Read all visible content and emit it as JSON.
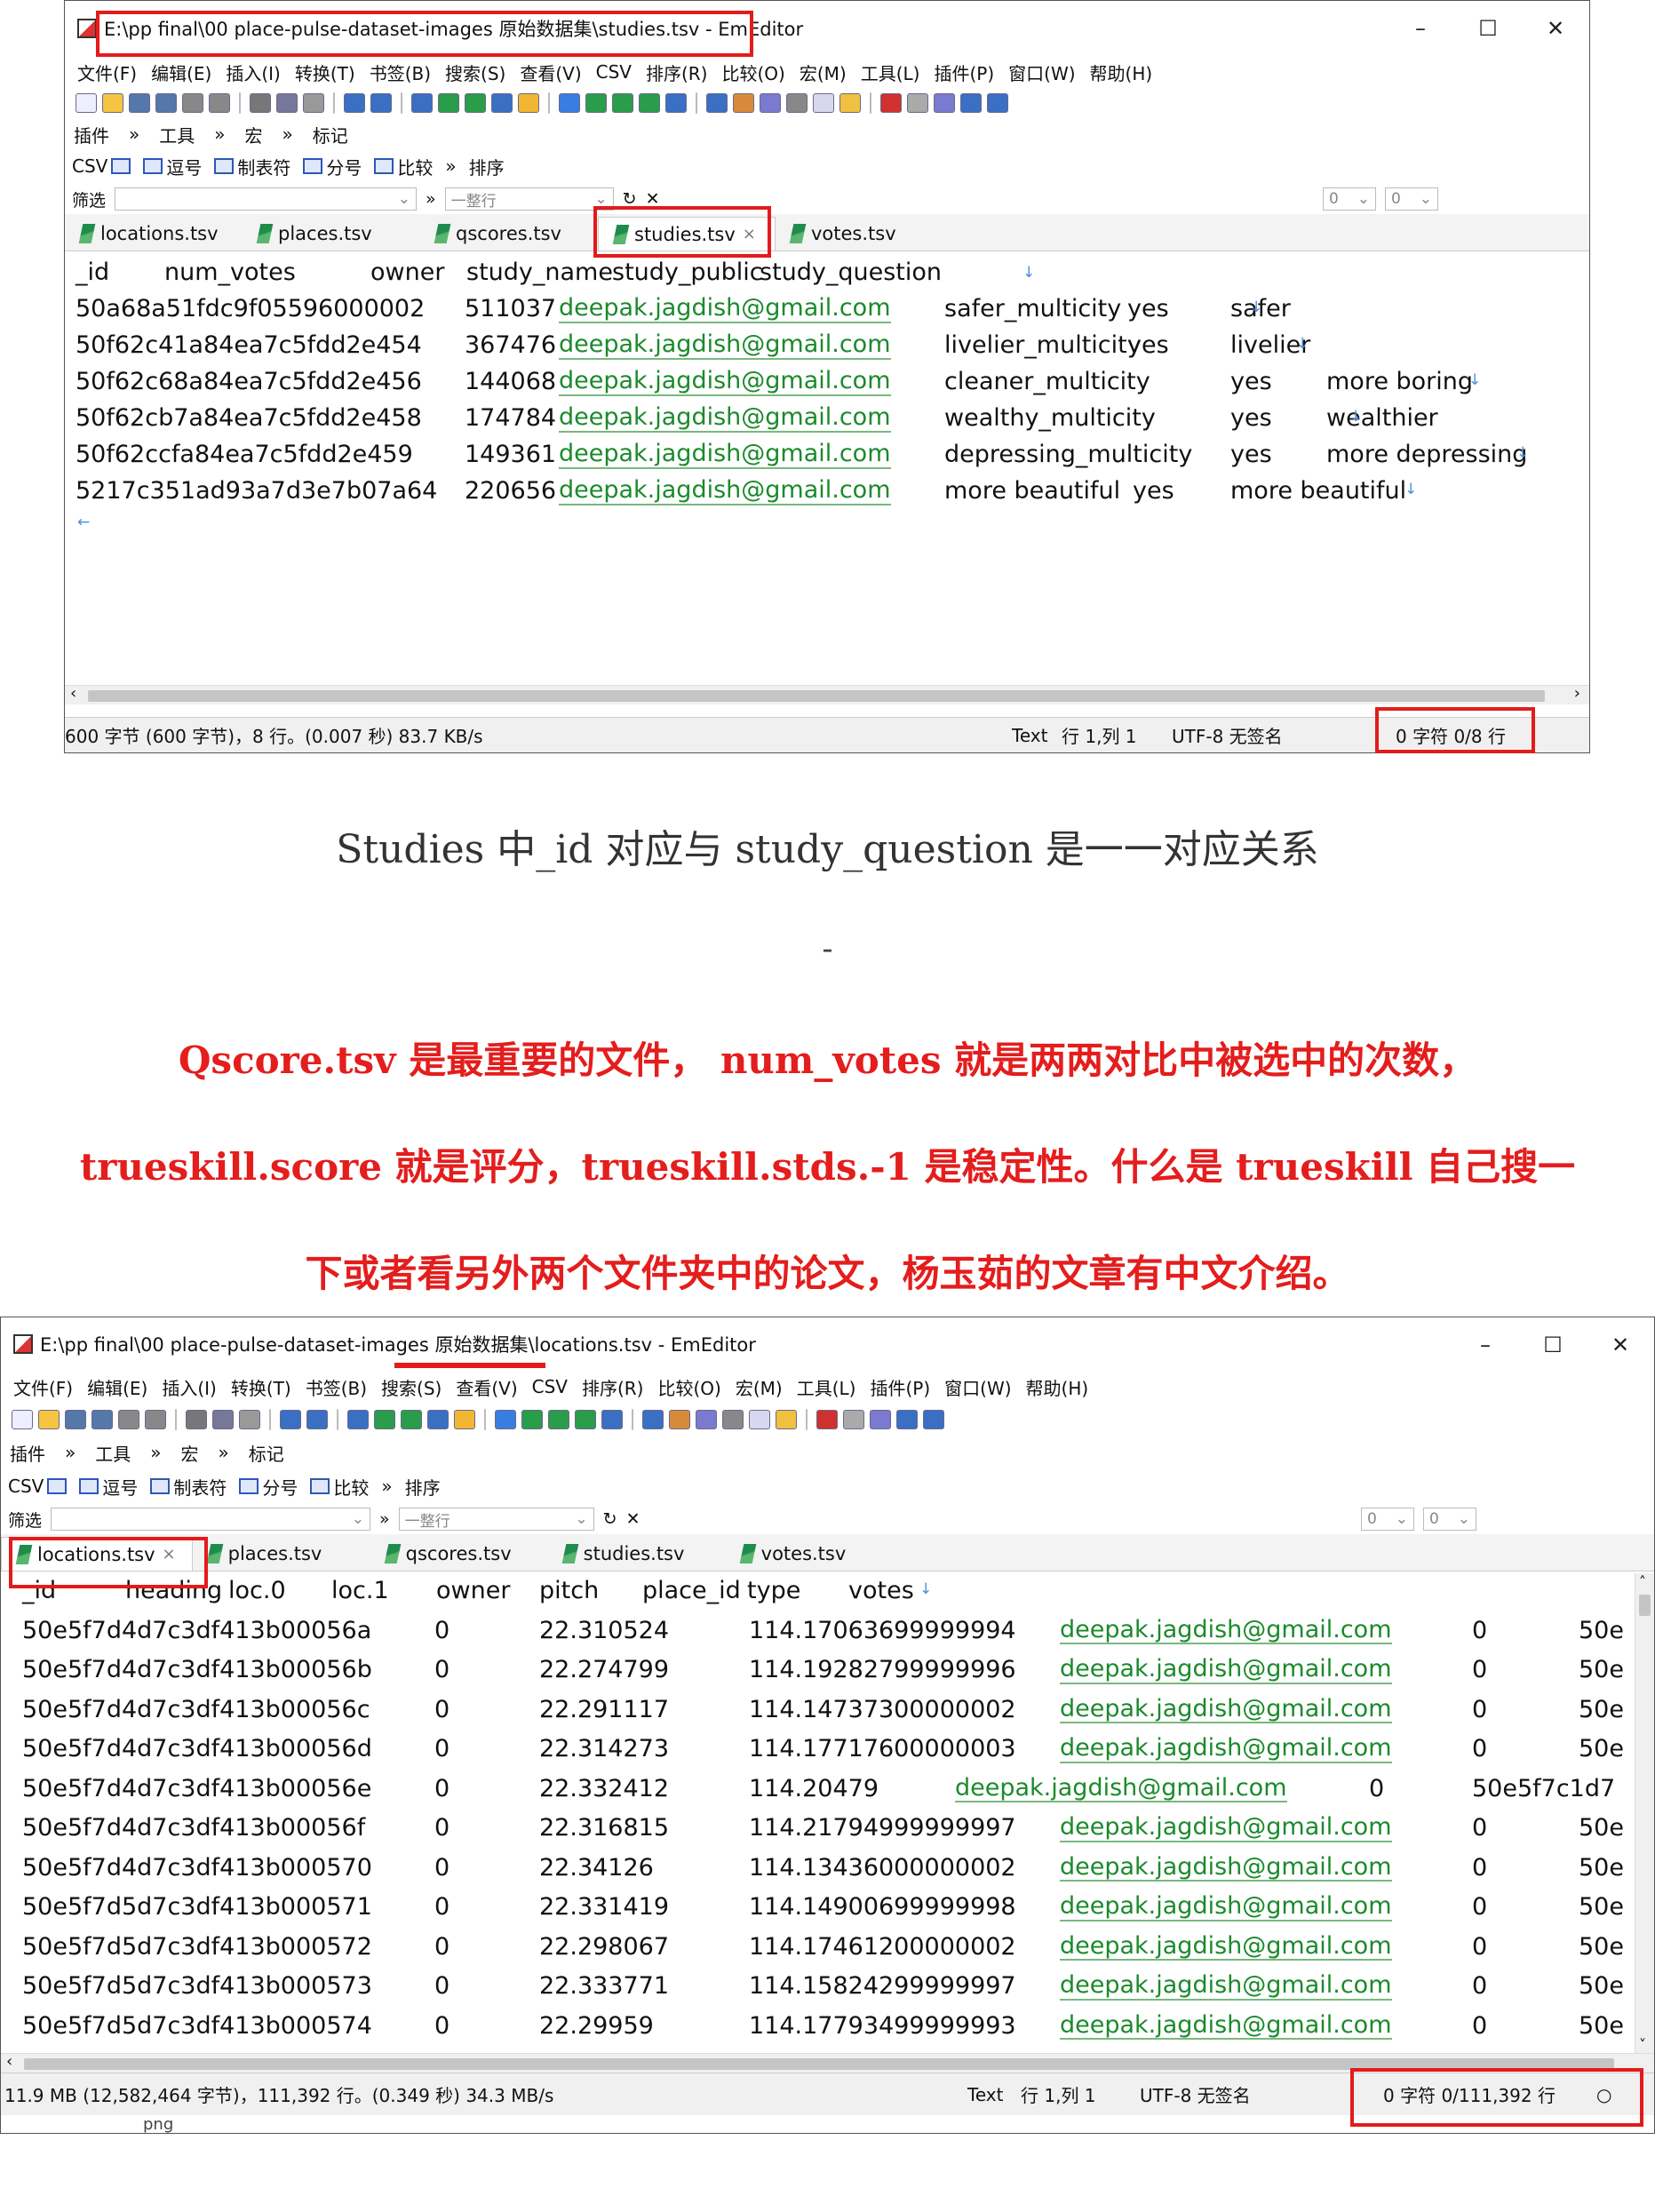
{
  "top": {
    "title": "E:\\pp final\\00 place-pulse-dataset-images 原始数据集\\studies.tsv - EmEditor",
    "window_controls": [
      "–",
      "☐",
      "✕"
    ],
    "menu": [
      "文件(F)",
      "编辑(E)",
      "插入(I)",
      "转换(T)",
      "书签(B)",
      "搜索(S)",
      "查看(V)",
      "CSV",
      "排序(R)",
      "比较(O)",
      "宏(M)",
      "工具(L)",
      "插件(P)",
      "窗口(W)",
      "帮助(H)"
    ],
    "toolbar_labels": [
      "插件",
      "»",
      "工具",
      "»",
      "宏",
      "»",
      "标记"
    ],
    "csv_bar": [
      "CSV",
      "逗号",
      "制表符",
      "分号",
      "比较",
      "»",
      "排序"
    ],
    "filter_label": "筛选",
    "filter_line_label": "一整行",
    "filter_num1": "0",
    "filter_num2": "0",
    "tabs": [
      "locations.tsv",
      "places.tsv",
      "qscores.tsv",
      "studies.tsv",
      "votes.tsv"
    ],
    "active_tab_index": 3,
    "header": [
      "_id",
      "num_votes",
      "owner",
      "study_name",
      "study_public",
      "study_question"
    ],
    "rows": [
      [
        "50a68a51fdc9f05596000002",
        "511037",
        "deepak.jagdish@gmail.com",
        "safer_multicity",
        "yes",
        "safer"
      ],
      [
        "50f62c41a84ea7c5fdd2e454",
        "367476",
        "deepak.jagdish@gmail.com",
        "livelier_multicity",
        "yes",
        "livelier"
      ],
      [
        "50f62c68a84ea7c5fdd2e456",
        "144068",
        "deepak.jagdish@gmail.com",
        "cleaner_multicity",
        "yes",
        "more boring"
      ],
      [
        "50f62cb7a84ea7c5fdd2e458",
        "174784",
        "deepak.jagdish@gmail.com",
        "wealthy_multicity",
        "yes",
        "wealthier"
      ],
      [
        "50f62ccfa84ea7c5fdd2e459",
        "149361",
        "deepak.jagdish@gmail.com",
        "depressing_multicity",
        "yes",
        "more depressing"
      ],
      [
        "5217c351ad93a7d3e7b07a64",
        "220656",
        "deepak.jagdish@gmail.com",
        "more beautiful",
        "yes",
        "more beautiful"
      ]
    ],
    "eol_mark": "↓",
    "eof_mark": "←",
    "status_left": "600 字节 (600 字节)，8 行。(0.007 秒) 83.7 KB/s",
    "status_mode": "Text",
    "status_pos": "行 1,列 1",
    "status_enc": "UTF-8 无签名",
    "status_sel": "0 字符  0/8 行"
  },
  "caption": "Studies 中_id 对应与 study_question 是一一对应关系",
  "dash": "-",
  "note_lines": [
    "Qscore.tsv 是最重要的文件，  num_votes 就是两两对比中被选中的次数，",
    "trueskill.score 就是评分，trueskill.stds.-1 是稳定性。什么是 trueskill 自己搜一",
    "下或者看另外两个文件夹中的论文，杨玉茹的文章有中文介绍。"
  ],
  "bottom": {
    "title": "E:\\pp final\\00 place-pulse-dataset-images 原始数据集\\locations.tsv - EmEditor",
    "window_controls": [
      "–",
      "☐",
      "✕"
    ],
    "menu": [
      "文件(F)",
      "编辑(E)",
      "插入(I)",
      "转换(T)",
      "书签(B)",
      "搜索(S)",
      "查看(V)",
      "CSV",
      "排序(R)",
      "比较(O)",
      "宏(M)",
      "工具(L)",
      "插件(P)",
      "窗口(W)",
      "帮助(H)"
    ],
    "toolbar_labels": [
      "插件",
      "»",
      "工具",
      "»",
      "宏",
      "»",
      "标记"
    ],
    "csv_bar": [
      "CSV",
      "逗号",
      "制表符",
      "分号",
      "比较",
      "»",
      "排序"
    ],
    "filter_label": "筛选",
    "filter_line_label": "一整行",
    "filter_num1": "0",
    "filter_num2": "0",
    "tabs": [
      "locations.tsv",
      "places.tsv",
      "qscores.tsv",
      "studies.tsv",
      "votes.tsv"
    ],
    "active_tab_index": 0,
    "header": [
      "_id",
      "heading",
      "loc.0",
      "loc.1",
      "owner",
      "pitch",
      "place_id",
      "type",
      "votes"
    ],
    "rows": [
      [
        "50e5f7d4d7c3df413b00056a",
        "0",
        "22.310524",
        "114.17063699999994",
        "deepak.jagdish@gmail.com",
        "0",
        "50e"
      ],
      [
        "50e5f7d4d7c3df413b00056b",
        "0",
        "22.274799",
        "114.19282799999996",
        "deepak.jagdish@gmail.com",
        "0",
        "50e"
      ],
      [
        "50e5f7d4d7c3df413b00056c",
        "0",
        "22.291117",
        "114.14737300000002",
        "deepak.jagdish@gmail.com",
        "0",
        "50e"
      ],
      [
        "50e5f7d4d7c3df413b00056d",
        "0",
        "22.314273",
        "114.17717600000003",
        "deepak.jagdish@gmail.com",
        "0",
        "50e"
      ],
      [
        "50e5f7d4d7c3df413b00056e",
        "0",
        "22.332412",
        "114.20479",
        "deepak.jagdish@gmail.com",
        "0",
        "50e5f7c1d7"
      ],
      [
        "50e5f7d4d7c3df413b00056f",
        "0",
        "22.316815",
        "114.21794999999997",
        "deepak.jagdish@gmail.com",
        "0",
        "50e"
      ],
      [
        "50e5f7d4d7c3df413b000570",
        "0",
        "22.34126",
        "114.13436000000002",
        "deepak.jagdish@gmail.com",
        "0",
        "50e"
      ],
      [
        "50e5f7d5d7c3df413b000571",
        "0",
        "22.331419",
        "114.14900699999998",
        "deepak.jagdish@gmail.com",
        "0",
        "50e"
      ],
      [
        "50e5f7d5d7c3df413b000572",
        "0",
        "22.298067",
        "114.17461200000002",
        "deepak.jagdish@gmail.com",
        "0",
        "50e"
      ],
      [
        "50e5f7d5d7c3df413b000573",
        "0",
        "22.333771",
        "114.15824299999997",
        "deepak.jagdish@gmail.com",
        "0",
        "50e"
      ],
      [
        "50e5f7d5d7c3df413b000574",
        "0",
        "22.29959",
        "114.17793499999993",
        "deepak.jagdish@gmail.com",
        "0",
        "50e"
      ]
    ],
    "eol_mark": "↓",
    "status_left": "11.9 MB (12,582,464 字节)，111,392 行。(0.349 秒) 34.3 MB/s",
    "status_mode": "Text",
    "status_pos": "行 1,列 1",
    "status_enc": "UTF-8 无签名",
    "status_sel": "0 字符  0/111,392 行",
    "cutoff_label": "png"
  },
  "colors": {
    "accent_red": "#e31b1b",
    "email_green": "#1b8a2c",
    "eol_blue": "#4a8de0"
  }
}
